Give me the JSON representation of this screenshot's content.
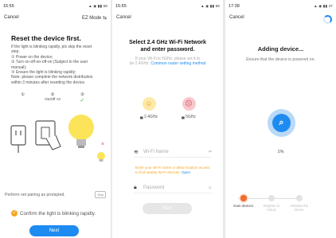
{
  "panel1": {
    "time": "15:55",
    "status_icons": "▲ ◉ ▮▮ 58",
    "cancel": "Cancel",
    "mode": "EZ Mode ⇆",
    "title": "Reset the device first.",
    "steps": [
      "If the light is blinking rapidly, pls skip the reset",
      "step.",
      "① Power on the device;",
      "② Turn on-off-on-off-on (Subject to the user",
      "manual);",
      "③ Ensure the light is blinking rapidly;",
      "Note: please complete the network distribution",
      "within 3 minutes after resetting the device."
    ],
    "illus_nums": [
      "①",
      "②",
      "③"
    ],
    "illus_caption": "On/Off ×3",
    "pair_text": "Perform net pairing as prompted.",
    "pair_tag": "Skip",
    "confirm_text": "Confirm the light is blinking rapidly.",
    "next": "Next"
  },
  "panel2": {
    "time": "15:55",
    "status_icons": "▲ ◉ ▮▮ 58",
    "cancel": "Cancel",
    "title_l1": "Select 2.4 GHz Wi-Fi Network",
    "title_l2": "and enter password.",
    "note_l1": "If your Wi-Fi is 5GHz, please set it to",
    "note_l2": "be 2.4GHz. ",
    "note_link": "Common router setting method",
    "band_ok": "2.4GHz",
    "band_bad": "5GHz",
    "ssid_placeholder": "Wi-Fi Name",
    "warn_text": "Enter your Wi-Fi name or allow location access to find nearby Wi-Fi devices. ",
    "warn_link": "Open",
    "pwd_placeholder": "Password",
    "next": "Next"
  },
  "panel3": {
    "time": "17:38",
    "status_icons": "▲ ◉ ▮▮ 47",
    "cancel": "Cancel",
    "title": "Adding device...",
    "subtitle": "Ensure that the device is powered on.",
    "percent": "1%",
    "progress": 0.01,
    "steps": [
      "Scan devices.",
      "Register to Cloud.",
      "Initialize the device."
    ]
  },
  "colors": {
    "accent": "#1e8bf0",
    "warning": "#f5a623",
    "active_step": "#f26b2c"
  }
}
